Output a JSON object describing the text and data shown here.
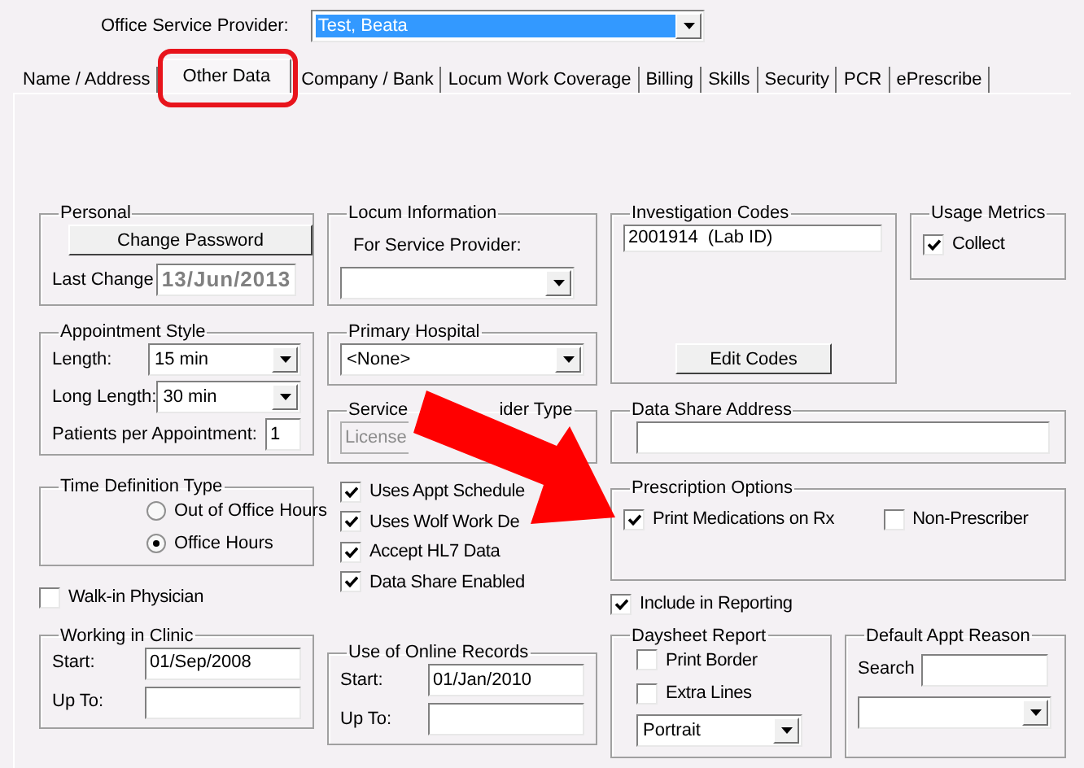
{
  "provider": {
    "label": "Office Service Provider:",
    "value": "Test, Beata"
  },
  "tabs": [
    {
      "label": "Name / Address",
      "selected": false
    },
    {
      "label": "Other Data",
      "selected": true
    },
    {
      "label": "Company / Bank",
      "selected": false
    },
    {
      "label": "Locum Work Coverage",
      "selected": false
    },
    {
      "label": "Billing",
      "selected": false
    },
    {
      "label": "Skills",
      "selected": false
    },
    {
      "label": "Security",
      "selected": false
    },
    {
      "label": "PCR",
      "selected": false
    },
    {
      "label": "ePrescribe",
      "selected": false
    }
  ],
  "personal": {
    "title": "Personal",
    "button": "Change Password",
    "last_change_label": "Last Change",
    "last_change": "13/Jun/2013"
  },
  "appointment_style": {
    "title": "Appointment Style",
    "fields": [
      {
        "label": "Length:",
        "value": "15 min",
        "kind": "dropdown"
      },
      {
        "label": "Long Length:",
        "value": "30 min",
        "kind": "dropdown"
      },
      {
        "label": "Patients per Appointment:",
        "value": "1",
        "kind": "text"
      }
    ]
  },
  "time_definition": {
    "title": "Time Definition Type",
    "options": [
      {
        "label": "Out of Office Hours",
        "selected": false
      },
      {
        "label": "Office Hours",
        "selected": true
      }
    ]
  },
  "walk_in": {
    "label": "Walk-in Physician",
    "checked": false
  },
  "working_in_clinic": {
    "title": "Working in Clinic",
    "start_label": "Start:",
    "start": "01/Sep/2008",
    "up_to_label": "Up To:"
  },
  "locum": {
    "title": "Locum Information",
    "field_label": "For Service Provider:"
  },
  "primary_hospital": {
    "title": "Primary Hospital",
    "value": "<None>"
  },
  "service_provider_type": {
    "title_parts": [
      "Service",
      "ider Type"
    ],
    "value": "License",
    "disabled": true
  },
  "flags": [
    {
      "label": "Uses Appt Schedule",
      "checked": true
    },
    {
      "label": "Uses Wolf Work De",
      "checked": true
    },
    {
      "label": "Accept HL7 Data",
      "checked": true
    },
    {
      "label": "Data Share Enabled",
      "checked": true
    }
  ],
  "online_records": {
    "title": "Use of Online Records",
    "start_label": "Start:",
    "start": "01/Jan/2010",
    "up_to_label": "Up To:"
  },
  "investigation_codes": {
    "title": "Investigation Codes",
    "items": [
      "2001914  (Lab ID)"
    ],
    "button": "Edit Codes"
  },
  "usage_metrics": {
    "title": "Usage Metrics",
    "option": {
      "label": "Collect",
      "checked": true
    }
  },
  "data_share_address": {
    "title": "Data Share Address"
  },
  "prescription_options": {
    "title": "Prescription Options",
    "options": [
      {
        "label": "Print Medications on Rx",
        "checked": true
      },
      {
        "label": "Non-Prescriber",
        "checked": false
      }
    ]
  },
  "include_in_reporting": {
    "label": "Include in Reporting",
    "checked": true
  },
  "daysheet_report": {
    "title": "Daysheet Report",
    "options": [
      {
        "label": "Print Border",
        "checked": false
      },
      {
        "label": "Extra Lines",
        "checked": false
      }
    ],
    "orientation": "Portrait"
  },
  "default_appt_reason": {
    "title": "Default Appt Reason",
    "search_label": "Search"
  }
}
